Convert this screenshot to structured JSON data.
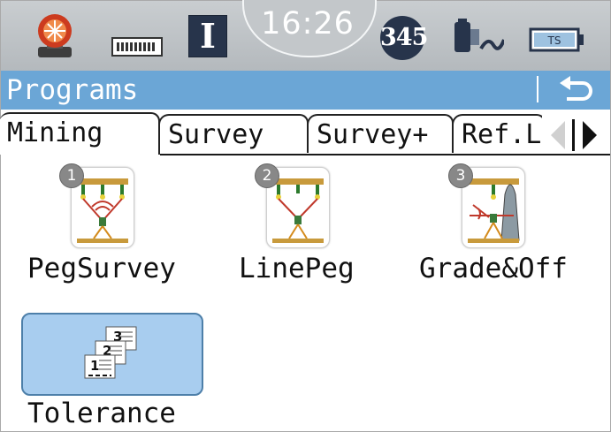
{
  "status": {
    "mode": "I",
    "time": "16:26",
    "face": "345",
    "battery_label": "TS",
    "icons": [
      "prism-icon",
      "battery-level-bar-icon",
      "edm-laser-icon",
      "battery-icon"
    ]
  },
  "titlebar": {
    "title": "Programs",
    "back_icon": "back-arrow-icon"
  },
  "tabs": [
    {
      "label": "Mining",
      "active": true
    },
    {
      "label": "Survey",
      "active": false
    },
    {
      "label": "Survey+",
      "active": false
    },
    {
      "label": "Ref.Line",
      "active": false
    }
  ],
  "programs": [
    {
      "number": "1",
      "label": "PegSurvey",
      "icon": "peg-survey-icon"
    },
    {
      "number": "2",
      "label": "LinePeg",
      "icon": "line-peg-icon"
    },
    {
      "number": "3",
      "label": "Grade&Off",
      "icon": "grade-offset-icon"
    },
    {
      "number": "",
      "label": "Tolerance",
      "icon": "tolerance-icon",
      "selected": true
    }
  ],
  "colors": {
    "titlebar": "#6ba6d6",
    "selection": "#a8cdef",
    "status_dark": "#27344b"
  }
}
